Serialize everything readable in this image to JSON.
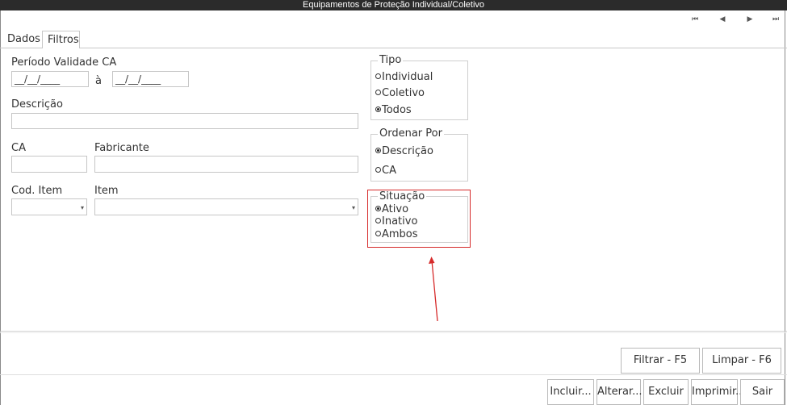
{
  "window": {
    "title": "Equipamentos de Proteção Individual/Coletivo"
  },
  "nav": {
    "first": "⏮",
    "prev": "◀",
    "next": "▶",
    "last": "⏭"
  },
  "tabs": [
    {
      "label": "Dados",
      "active": false
    },
    {
      "label": "Filtros",
      "active": true
    }
  ],
  "filters": {
    "periodo_label": "Período Validade CA",
    "date_from": "__/__/____",
    "date_separator": "à",
    "date_to": "__/__/____",
    "descricao_label": "Descrição",
    "descricao_value": "",
    "ca_label": "CA",
    "ca_value": "",
    "fabricante_label": "Fabricante",
    "fabricante_value": "",
    "cod_item_label": "Cod. Item",
    "cod_item_value": "",
    "item_label": "Item",
    "item_value": ""
  },
  "tipo": {
    "legend": "Tipo",
    "options": [
      {
        "label": "Individual",
        "selected": false
      },
      {
        "label": "Coletivo",
        "selected": false
      },
      {
        "label": "Todos",
        "selected": true
      }
    ]
  },
  "ordenar": {
    "legend": "Ordenar Por",
    "options": [
      {
        "label": "Descrição",
        "selected": true
      },
      {
        "label": "CA",
        "selected": false
      }
    ]
  },
  "situacao": {
    "legend": "Situação",
    "options": [
      {
        "label": "Ativo",
        "selected": true
      },
      {
        "label": "Inativo",
        "selected": false
      },
      {
        "label": "Ambos",
        "selected": false
      }
    ]
  },
  "actions": {
    "filtrar": "Filtrar - F5",
    "limpar": "Limpar - F6",
    "incluir": "Incluir...",
    "alterar": "Alterar...",
    "excluir": "Excluir",
    "imprimir": "Imprimir...",
    "sair": "Sair"
  },
  "colors": {
    "highlight": "#d62a2a",
    "titlebar": "#2b2b2b"
  }
}
